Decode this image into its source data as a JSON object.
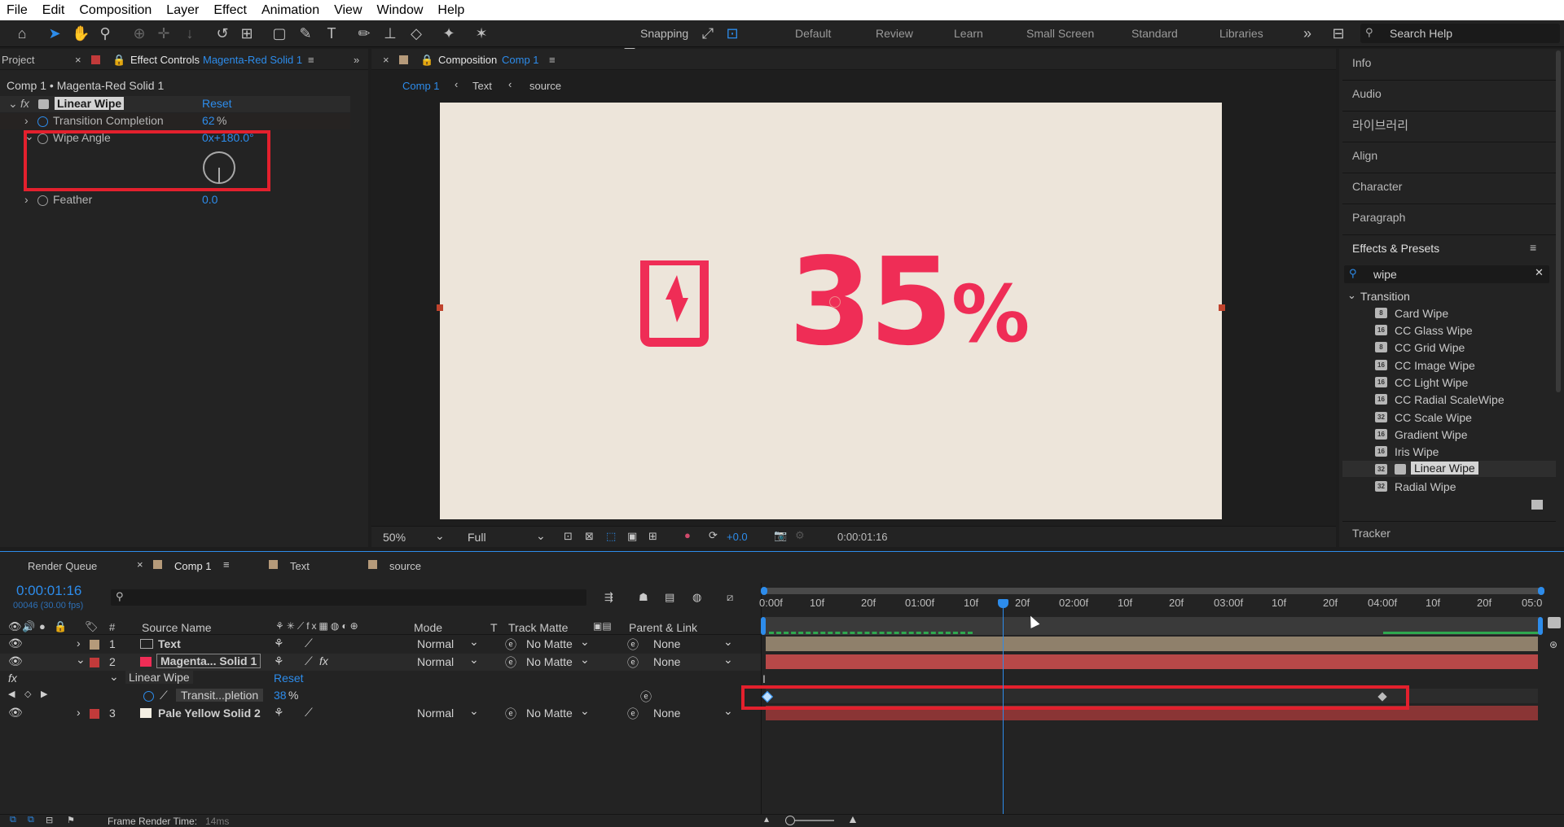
{
  "menu": [
    "File",
    "Edit",
    "Composition",
    "Layer",
    "Effect",
    "Animation",
    "View",
    "Window",
    "Help"
  ],
  "toolbar": {
    "snapping_label": "Snapping",
    "workspaces": [
      "Default",
      "Review",
      "Learn",
      "Small Screen",
      "Standard",
      "Libraries"
    ],
    "search_placeholder": "Search Help"
  },
  "effect_controls": {
    "project_tab": "Project",
    "tab_label": "Effect Controls",
    "tab_layer": "Magenta-Red Solid 1",
    "breadcrumb": "Comp 1 • Magenta-Red Solid 1",
    "effect_name": "Linear Wipe",
    "reset_label": "Reset",
    "properties": [
      {
        "name": "Transition Completion",
        "value": "62",
        "unit": "%"
      },
      {
        "name": "Wipe Angle",
        "value": "0x+180.0°"
      },
      {
        "name": "Feather",
        "value": "0.0"
      }
    ]
  },
  "composition": {
    "tab_label": "Composition",
    "tab_comp": "Comp 1",
    "breadcrumbs": [
      "Comp 1",
      "Text",
      "source"
    ],
    "canvas_text": "35",
    "canvas_percent": "%",
    "zoom": "50%",
    "resolution": "Full",
    "exposure": "+0.0",
    "timecode": "0:00:01:16"
  },
  "right_panels": {
    "items": [
      "Info",
      "Audio",
      "라이브러리",
      "Align",
      "Character",
      "Paragraph"
    ],
    "effects_title": "Effects & Presets",
    "search_value": "wipe",
    "category": "Transition",
    "effects": [
      {
        "badge": "8",
        "name": "Card Wipe"
      },
      {
        "badge": "16",
        "name": "CC Glass Wipe"
      },
      {
        "badge": "8",
        "name": "CC Grid Wipe"
      },
      {
        "badge": "16",
        "name": "CC Image Wipe"
      },
      {
        "badge": "16",
        "name": "CC Light Wipe"
      },
      {
        "badge": "16",
        "name": "CC Radial ScaleWipe"
      },
      {
        "badge": "32",
        "name": "CC Scale Wipe"
      },
      {
        "badge": "16",
        "name": "Gradient Wipe"
      },
      {
        "badge": "16",
        "name": "Iris Wipe"
      },
      {
        "badge": "32",
        "name": "Linear Wipe"
      },
      {
        "badge": "32",
        "name": "Radial Wipe"
      }
    ],
    "tracker": "Tracker"
  },
  "timeline": {
    "tabs": [
      "Render Queue",
      "Comp 1",
      "Text",
      "source"
    ],
    "timecode": "0:00:01:16",
    "frame_info": "00046 (30.00 fps)",
    "columns": {
      "source_name": "Source Name",
      "mode": "Mode",
      "t": "T",
      "track_matte": "Track Matte",
      "parent": "Parent & Link"
    },
    "layers": [
      {
        "num": "1",
        "name": "Text",
        "mode": "Normal",
        "matte": "No Matte",
        "parent": "None",
        "color": "#b59a7a"
      },
      {
        "num": "2",
        "name": "Magenta... Solid 1",
        "mode": "Normal",
        "matte": "No Matte",
        "parent": "None",
        "color": "#c23a3a"
      },
      {
        "num": "3",
        "name": "Pale Yellow Solid 2",
        "mode": "Normal",
        "matte": "No Matte",
        "parent": "None",
        "color": "#c23a3a"
      }
    ],
    "effect_label": "Linear Wipe",
    "effect_reset": "Reset",
    "prop_name": "Transit...pletion",
    "prop_value": "38",
    "prop_unit": "%",
    "ruler": [
      "0:00f",
      "10f",
      "20f",
      "01:00f",
      "10f",
      "20f",
      "02:00f",
      "10f",
      "20f",
      "03:00f",
      "10f",
      "20f",
      "04:00f",
      "10f",
      "20f",
      "05:0"
    ],
    "render_time_label": "Frame Render Time:",
    "render_time_value": "14ms"
  },
  "colors": {
    "accent": "#2d8ceb",
    "highlight": "#e3202d",
    "magenta": "#ef2d56",
    "canvas": "#ede5da"
  }
}
